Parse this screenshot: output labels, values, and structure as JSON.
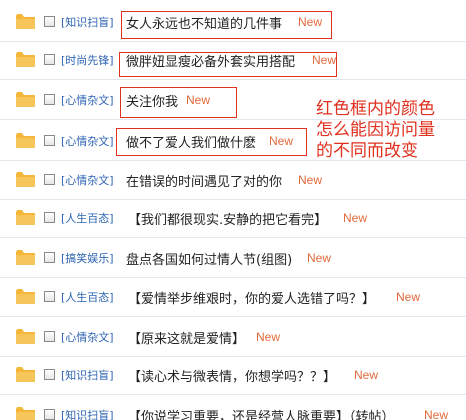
{
  "posts": [
    {
      "category": "[知识扫盲]",
      "title": "女人永远也不知道的几件事",
      "badge": "New"
    },
    {
      "category": "[时尚先锋]",
      "title": "微胖妞显瘦必备外套实用搭配",
      "badge": "New"
    },
    {
      "category": "[心情杂文]",
      "title": "关注你我",
      "badge": "New"
    },
    {
      "category": "[心情杂文]",
      "title": "做不了爱人我们做什麽",
      "badge": "New"
    },
    {
      "category": "[心情杂文]",
      "title": "在错误的时间遇见了对的你",
      "badge": "New"
    },
    {
      "category": "[人生百态]",
      "title": "【我们都很现实.安静的把它看完】",
      "badge": "New"
    },
    {
      "category": "[搞笑娱乐]",
      "title": "盘点各国如何过情人节(组图)",
      "badge": "New"
    },
    {
      "category": "[人生百态]",
      "title": "【爱情举步维艰时，你的爱人选错了吗？】",
      "badge": "New"
    },
    {
      "category": "[心情杂文]",
      "title": "【原来这就是爱情】",
      "badge": "New"
    },
    {
      "category": "[知识扫盲]",
      "title": "【读心术与微表情，你想学吗？？】",
      "badge": "New"
    },
    {
      "category": "[知识扫盲]",
      "title": "【你说学习重要，还是经营人脉重要】（转帖）",
      "badge": "New"
    }
  ],
  "annotation": {
    "lines": [
      "红色框内的颜色",
      "怎么能因访问量",
      "的不同而改变"
    ]
  },
  "colors": {
    "category": "#2d64b3",
    "title": "#222222",
    "new_badge": "#e26a3c",
    "annotation_red": "#e0301e",
    "folder": "#f4b73a"
  }
}
